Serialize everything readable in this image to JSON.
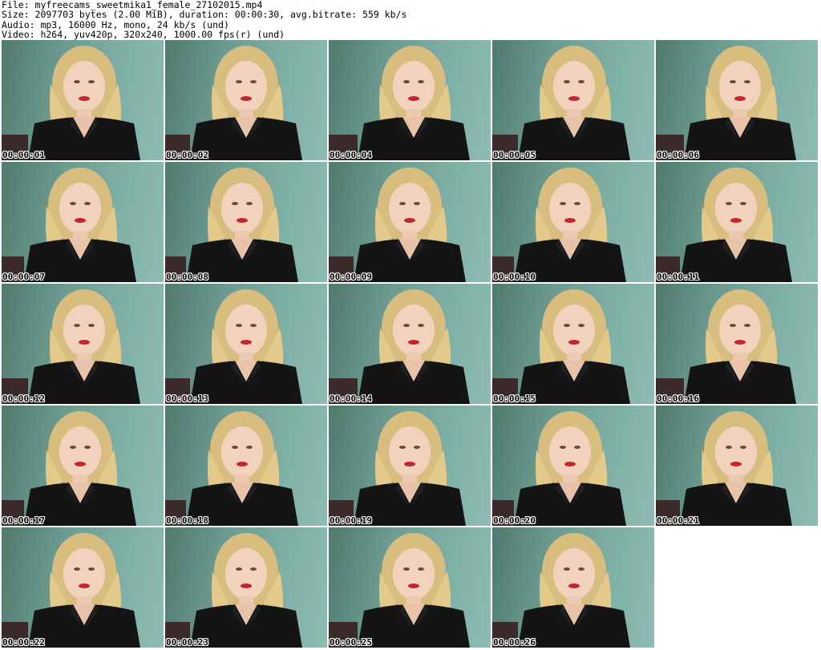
{
  "header": {
    "file": "File: myfreecams_sweetmika1_female_27102015.mp4",
    "size": "Size: 2097703 bytes (2.00 MiB), duration: 00:00:30, avg.bitrate: 559 kb/s",
    "audio": "Audio: mp3, 16000 Hz, mono, 24 kb/s (und)",
    "video": "Video: h264, yuv420p, 320x240, 1000.00 fps(r) (und)"
  },
  "thumbnails": [
    {
      "time": "00:00:01"
    },
    {
      "time": "00:00:02"
    },
    {
      "time": "00:00:04"
    },
    {
      "time": "00:00:05"
    },
    {
      "time": "00:00:06"
    },
    {
      "time": "00:00:07"
    },
    {
      "time": "00:00:08"
    },
    {
      "time": "00:00:09"
    },
    {
      "time": "00:00:10"
    },
    {
      "time": "00:00:11"
    },
    {
      "time": "00:00:12"
    },
    {
      "time": "00:00:13"
    },
    {
      "time": "00:00:14"
    },
    {
      "time": "00:00:15"
    },
    {
      "time": "00:00:16"
    },
    {
      "time": "00:00:17"
    },
    {
      "time": "00:00:18"
    },
    {
      "time": "00:00:19"
    },
    {
      "time": "00:00:20"
    },
    {
      "time": "00:00:21"
    },
    {
      "time": "00:00:22"
    },
    {
      "time": "00:00:23"
    },
    {
      "time": "00:00:25"
    },
    {
      "time": "00:00:26"
    }
  ],
  "colors": {
    "background": "#ffffff",
    "wall": "#7fb0a6",
    "hair": "#e3c98a",
    "skin": "#f1d2bd",
    "shirt": "#141414"
  }
}
